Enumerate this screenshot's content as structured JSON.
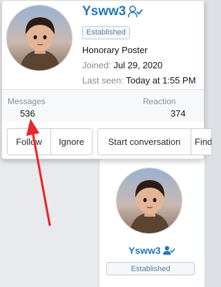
{
  "popover": {
    "username": "Ysww3",
    "badge": "Established",
    "user_title": "Honorary Poster",
    "joined_label": "Joined:",
    "joined_value": "Jul 29, 2020",
    "last_seen_label": "Last seen:",
    "last_seen_value": "Today at 1:55 PM",
    "stats": {
      "messages_label": "Messages",
      "messages_value": "536",
      "reaction_label": "Reaction",
      "reaction_value": "374"
    },
    "buttons": {
      "follow": "Follow",
      "ignore": "Ignore",
      "start_conversation": "Start conversation",
      "find": "Find"
    }
  },
  "profile_stub": {
    "username": "Ysww3",
    "badge": "Established"
  },
  "colors": {
    "username": "#2577b1",
    "annotation_arrow": "#e8262b",
    "badge_border": "#bcc9d6"
  },
  "icons": {
    "user_check": "user-check-icon"
  }
}
